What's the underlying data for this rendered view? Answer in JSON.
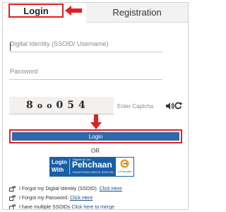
{
  "tabs": {
    "login": "Login",
    "registration": "Registration"
  },
  "form": {
    "username_placeholder": "Digital Identity (SSOID/ Username)",
    "password_placeholder": "Password",
    "captcha_chars": [
      "8",
      "o",
      "o",
      "0",
      "5",
      "4"
    ],
    "captcha_placeholder": "Enter Captcha",
    "login_button": "Login",
    "or_text": "OR"
  },
  "jan_pehchaan": {
    "login_with": [
      "Login",
      "With"
    ],
    "small_top": "Rajasthan Jan",
    "name": "Pehchaan",
    "small_bottom": "RAJASTHAN SINGLE SIGN ON",
    "epramaan": "e-Pramaan"
  },
  "help_links": [
    {
      "text": "I Forgot my Digital Identity (SSOID). ",
      "link": "Click Here"
    },
    {
      "text": "I Forgot my Password. ",
      "link": "Click Here"
    },
    {
      "text": "I have multiple SSOIDs ",
      "link": "Click here to merge"
    }
  ],
  "icons": {
    "audio": "speaker-icon",
    "refresh": "refresh-icon",
    "hand": "pointing-hand-icon",
    "arrow_left": "red-arrow-left-icon",
    "arrow_down": "red-arrow-down-icon"
  },
  "colors": {
    "accent_red": "#e02020",
    "button_blue": "#2f6aa8",
    "link_blue": "#1b4f8c",
    "banner_blue": "#1a5fa6"
  }
}
